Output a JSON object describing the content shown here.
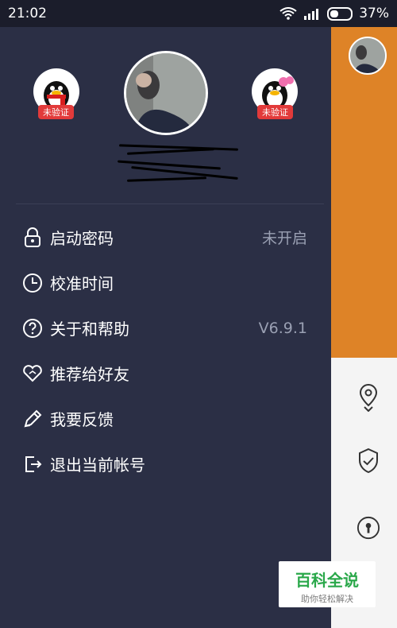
{
  "status": {
    "time": "21:02",
    "battery": "37%"
  },
  "profile": {
    "badge_left": "未验证",
    "badge_right": "未验证"
  },
  "menu": [
    {
      "label": "启动密码",
      "value": "未开启"
    },
    {
      "label": "校准时间",
      "value": ""
    },
    {
      "label": "关于和帮助",
      "value": "V6.9.1"
    },
    {
      "label": "推荐给好友",
      "value": ""
    },
    {
      "label": "我要反馈",
      "value": ""
    },
    {
      "label": "退出当前帐号",
      "value": ""
    }
  ],
  "watermark": {
    "title": "百科全说",
    "subtitle": "助你轻松解决"
  },
  "colors": {
    "drawer_bg": "#2b2f45",
    "accent": "#de8327",
    "badge": "#e23a3a"
  },
  "icons": [
    "lock-icon",
    "clock-icon",
    "help-icon",
    "heart-icon",
    "pencil-icon",
    "logout-icon",
    "location-pin-icon",
    "shield-check-icon",
    "keyhole-icon"
  ]
}
